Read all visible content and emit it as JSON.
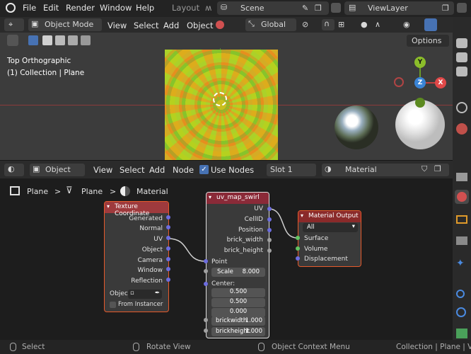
{
  "menubar": {
    "items": [
      "File",
      "Edit",
      "Render",
      "Window",
      "Help"
    ],
    "workspace_tab": "Layout",
    "scene": "Scene",
    "view_layer": "ViewLayer"
  },
  "viewport_header": {
    "mode": "Object Mode",
    "menus": [
      "View",
      "Select",
      "Add",
      "Object"
    ],
    "orientation": "Global",
    "options": "Options"
  },
  "viewport": {
    "view_name": "Top Orthographic",
    "collection_info": "(1) Collection | Plane",
    "gizmo": {
      "y": "Y",
      "z": "Z",
      "x": "X"
    }
  },
  "node_header": {
    "type": "Object",
    "menus": [
      "View",
      "Select",
      "Add",
      "Node"
    ],
    "use_nodes_label": "Use Nodes",
    "use_nodes_checked": true,
    "slot": "Slot 1",
    "material": "Material"
  },
  "breadcrumb": {
    "items": [
      "Plane",
      "Plane",
      "Material"
    ],
    "separator": ">"
  },
  "nodes": {
    "texture_coordinate": {
      "title": "Texture Coordinate",
      "outputs": [
        "Generated",
        "Normal",
        "UV",
        "Object",
        "Camera",
        "Window",
        "Reflection"
      ],
      "object_label": "Object:",
      "from_instancer": "From Instancer"
    },
    "uv_map_swirl": {
      "title": "uv_map_swirl",
      "outputs": [
        "UV",
        "CellID",
        "Position",
        "brick_width",
        "brick_height"
      ],
      "point": "Point",
      "scale_label": "Scale",
      "scale_value": "8.000",
      "center_label": "Center:",
      "center": [
        "0.500",
        "0.500",
        "0.000"
      ],
      "brickwidth_label": "brickwidth",
      "brickwidth_value": "1.000",
      "brickheight_label": "brickheight",
      "brickheight_value": "1.000"
    },
    "material_output": {
      "title": "Material Output",
      "target": "All",
      "inputs": [
        "Surface",
        "Volume",
        "Displacement"
      ]
    }
  },
  "statusbar": {
    "select": "Select",
    "rotate": "Rotate View",
    "context": "Object Context Menu",
    "info": "Collection | Plane | Vert"
  },
  "colors": {
    "accent_blue": "#4772b3",
    "node_border": "#e65a2b",
    "group_header": "#8a2a38",
    "texcoord_header": "#9e3a3d",
    "output_header": "#8a2a2a",
    "socket_purple": "#6d6de0",
    "socket_yellow": "#c7c729",
    "socket_green": "#62c462",
    "socket_grey": "#a1a1a1"
  }
}
